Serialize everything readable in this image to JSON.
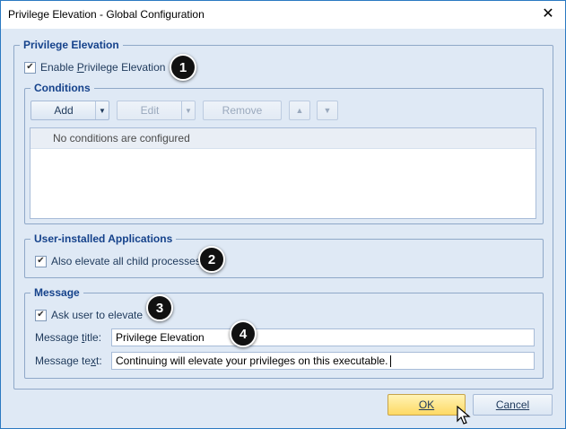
{
  "window": {
    "title": "Privilege Elevation - Global Configuration"
  },
  "privilege_elevation": {
    "legend": "Privilege Elevation",
    "enable_label": "Enable Privilege Elevation",
    "enable_checked": true
  },
  "conditions": {
    "legend": "Conditions",
    "buttons": {
      "add": "Add",
      "edit": "Edit",
      "remove": "Remove"
    },
    "empty_text": "No conditions are configured"
  },
  "user_installed": {
    "legend": "User-installed Applications",
    "child_label": "Also elevate all child processes",
    "child_checked": true
  },
  "message": {
    "legend": "Message",
    "ask_label": "Ask user to elevate",
    "ask_checked": true,
    "title_label": "Message title:",
    "title_value": "Privilege Elevation",
    "text_label": "Message text:",
    "text_value": "Continuing will elevate your privileges on this executable."
  },
  "footer": {
    "ok": "OK",
    "cancel": "Cancel"
  },
  "markers": [
    "1",
    "2",
    "3",
    "4"
  ]
}
